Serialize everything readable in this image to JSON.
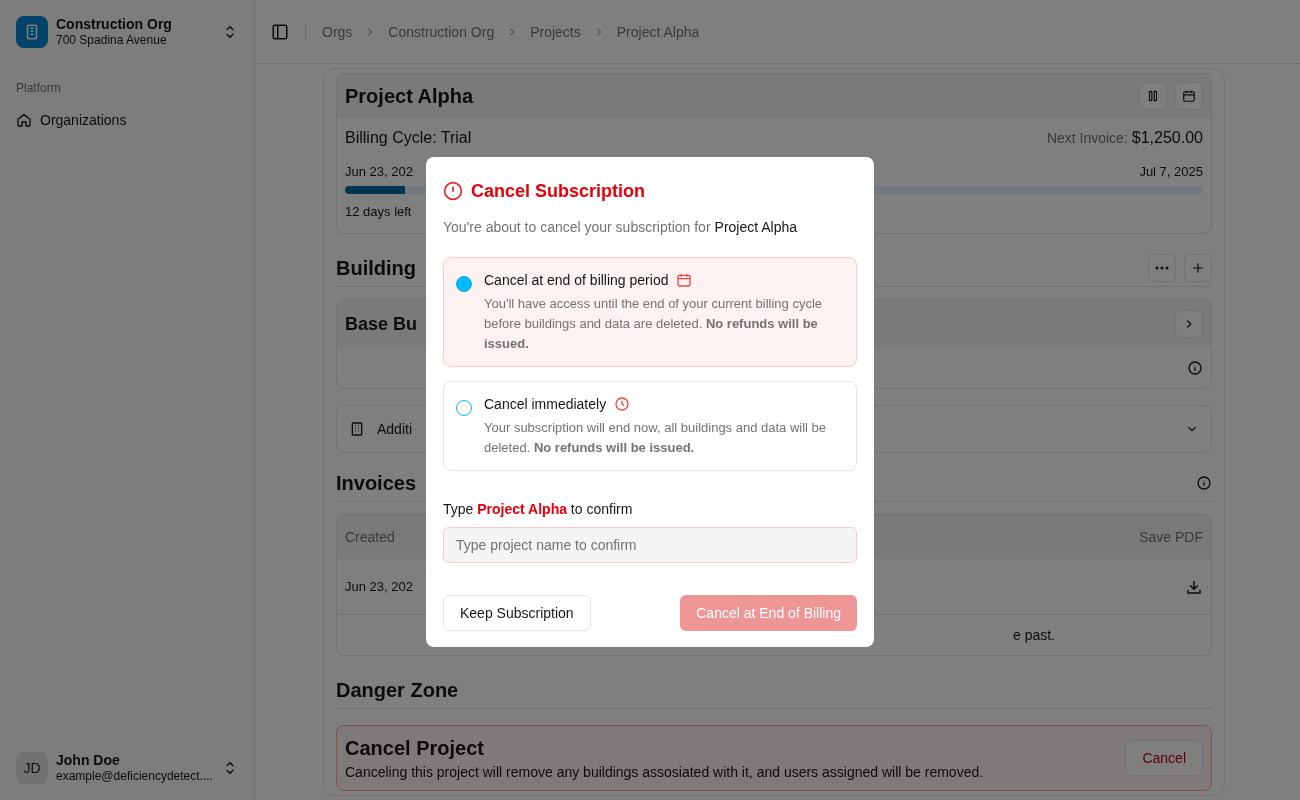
{
  "sidebar": {
    "org": {
      "name": "Construction Org",
      "address": "700 Spadina Avenue"
    },
    "section_label": "Platform",
    "items": [
      {
        "label": "Organizations",
        "selected": false
      }
    ],
    "user": {
      "initials": "JD",
      "name": "John Doe",
      "email": "example@deficiencydetect...."
    }
  },
  "breadcrumb": [
    "Orgs",
    "Construction Org",
    "Projects",
    "Project Alpha"
  ],
  "project": {
    "title": "Project Alpha",
    "billing_cycle": "Billing Cycle: Trial",
    "next_invoice_label": "Next Invoice:",
    "next_invoice_amount": "$1,250.00",
    "start_date": "Jun 23, 202",
    "end_date": "Jul 7, 2025",
    "level": 0.07,
    "days_left": "12 days left"
  },
  "buildings": {
    "heading": "Building",
    "base_title": "Base Bu",
    "additional": "Additi"
  },
  "invoices": {
    "heading": "Invoices",
    "columns": [
      "Created",
      "Save PDF"
    ],
    "rows": [
      {
        "created": "Jun 23, 202"
      }
    ],
    "note": "e past."
  },
  "danger_zone": {
    "heading": "Danger Zone",
    "title": "Cancel Project",
    "description": "Canceling this project will remove any buildings assosiated with it, and users assigned will be removed.",
    "button": "Cancel"
  },
  "dialog": {
    "title": "Cancel Subscription",
    "intro": "You're about to cancel your subscription for",
    "intro_project": "Project Alpha",
    "options": [
      {
        "kind": "calendar",
        "label": "Cancel at end of billing period",
        "description": "You'll have access until the end of your current billing cycle before buildings and data are deleted. **No refunds will be issued.**",
        "selected": true
      },
      {
        "kind": "clock",
        "label": "Cancel immediately",
        "description": "Your subscription will end now, all buildings and data will be deleted. **No refunds will be issued.**",
        "selected": false
      }
    ],
    "confirm_label": "Type **Project Alpha** to confirm",
    "confirm_placeholder": "Type project name to confirm",
    "keep_button": "Keep Subscription",
    "confirm_button": {
      "label": "Cancel at End of Billing",
      "disabled": true
    }
  }
}
